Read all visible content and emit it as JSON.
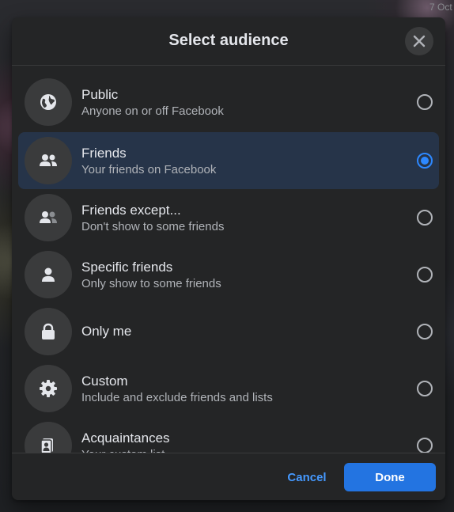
{
  "background": {
    "date_text": "7 Oct"
  },
  "dialog": {
    "title": "Select audience",
    "close_icon": "close-icon",
    "options": [
      {
        "label": "Public",
        "description": "Anyone on or off Facebook",
        "icon": "globe-icon",
        "selected": false
      },
      {
        "label": "Friends",
        "description": "Your friends on Facebook",
        "icon": "friends-icon",
        "selected": true
      },
      {
        "label": "Friends except...",
        "description": "Don't show to some friends",
        "icon": "friends-except-icon",
        "selected": false
      },
      {
        "label": "Specific friends",
        "description": "Only show to some friends",
        "icon": "person-icon",
        "selected": false
      },
      {
        "label": "Only me",
        "description": "",
        "icon": "lock-icon",
        "selected": false
      },
      {
        "label": "Custom",
        "description": "Include and exclude friends and lists",
        "icon": "gear-icon",
        "selected": false
      },
      {
        "label": "Acquaintances",
        "description": "Your custom list",
        "icon": "acquaintances-icon",
        "selected": false
      }
    ],
    "cancel_label": "Cancel",
    "done_label": "Done"
  },
  "colors": {
    "dialog_bg": "#242526",
    "selected_row_bg": "#263449",
    "accent_blue": "#2d88ff",
    "done_button_bg": "#2374e1",
    "primary_text": "#e4e6eb",
    "secondary_text": "#b0b3b8"
  }
}
